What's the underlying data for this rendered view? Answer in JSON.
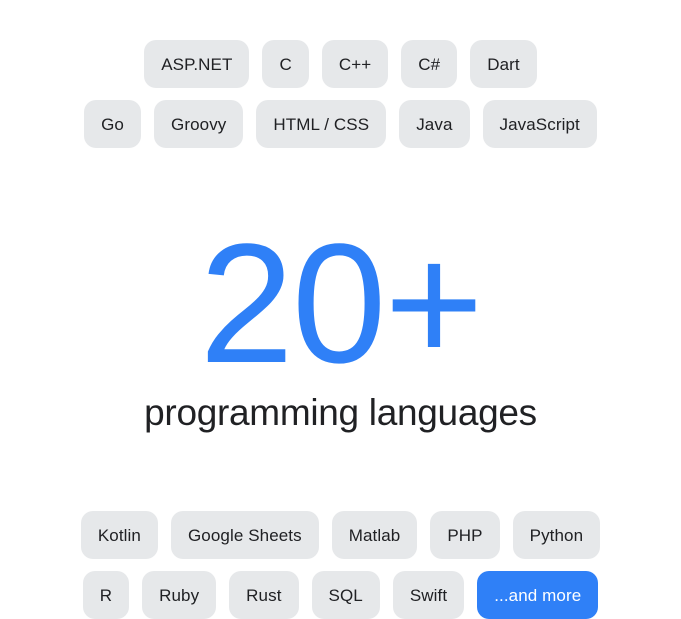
{
  "hero": {
    "headline_number": "20+",
    "subtitle": "programming languages",
    "accent_color": "#2f80f7",
    "chip_background": "#e6e8ea",
    "text_color": "#202124",
    "page_background": "#ffffff"
  },
  "top_rows": [
    {
      "row_name": "languages-row-1",
      "chips": [
        {
          "label": "ASP.NET",
          "accent": false
        },
        {
          "label": "C",
          "accent": false
        },
        {
          "label": "C++",
          "accent": false
        },
        {
          "label": "C#",
          "accent": false
        },
        {
          "label": "Dart",
          "accent": false
        }
      ]
    },
    {
      "row_name": "languages-row-2",
      "chips": [
        {
          "label": "Go",
          "accent": false
        },
        {
          "label": "Groovy",
          "accent": false
        },
        {
          "label": "HTML / CSS",
          "accent": false
        },
        {
          "label": "Java",
          "accent": false
        },
        {
          "label": "JavaScript",
          "accent": false
        }
      ]
    }
  ],
  "bottom_rows": [
    {
      "row_name": "languages-row-3",
      "chips": [
        {
          "label": "Kotlin",
          "accent": false
        },
        {
          "label": "Google Sheets",
          "accent": false
        },
        {
          "label": "Matlab",
          "accent": false
        },
        {
          "label": "PHP",
          "accent": false
        },
        {
          "label": "Python",
          "accent": false
        }
      ]
    },
    {
      "row_name": "languages-row-4",
      "chips": [
        {
          "label": "R",
          "accent": false
        },
        {
          "label": "Ruby",
          "accent": false
        },
        {
          "label": "Rust",
          "accent": false
        },
        {
          "label": "SQL",
          "accent": false
        },
        {
          "label": "Swift",
          "accent": false
        },
        {
          "label": "...and more",
          "accent": true
        }
      ]
    }
  ]
}
